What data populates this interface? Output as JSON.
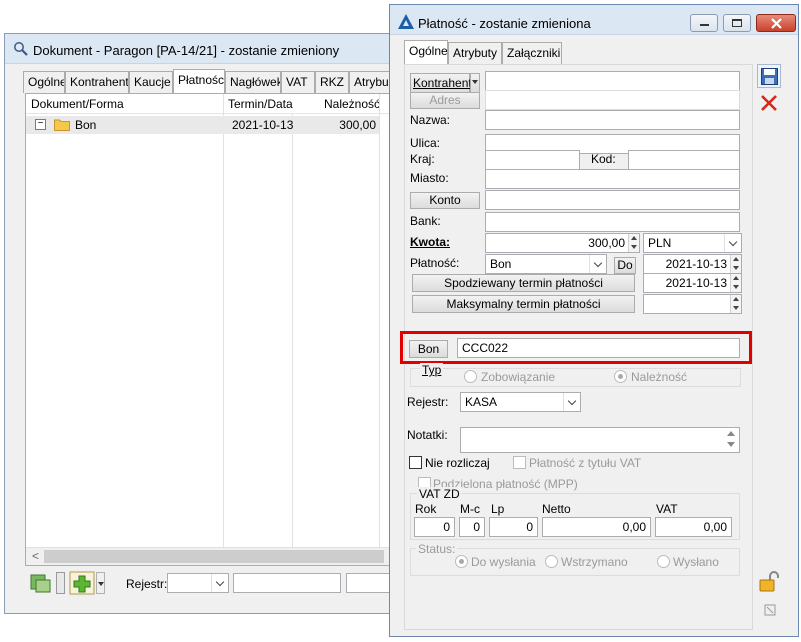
{
  "back": {
    "title": "Dokument - Paragon [PA-14/21]  - zostanie zmieniony",
    "tabs": [
      "Ogólne",
      "Kontrahent",
      "Kaucje",
      "Płatności",
      "Nagłówek",
      "VAT",
      "RKZ",
      "Atrybu"
    ],
    "columns": [
      "Dokument/Forma",
      "Termin/Data",
      "Należność"
    ],
    "row": {
      "toggle": "−",
      "name": "Bon",
      "date": "2021-10-13",
      "amount": "300,00"
    },
    "scroll_left": "<",
    "rejestr_label": "Rejestr:"
  },
  "front": {
    "title": "Płatność - zostanie zmieniona",
    "tabs": [
      "Ogólne",
      "Atrybuty",
      "Załączniki"
    ],
    "kontrahent_btn": "Kontrahent",
    "adres_btn": "Adres",
    "nazwa": "Nazwa:",
    "ulica": "Ulica:",
    "kraj": "Kraj:",
    "kod": "Kod:",
    "miasto": "Miasto:",
    "konto_btn": "Konto",
    "bank": "Bank:",
    "kwota_label": "Kwota:",
    "kwota_value": "300,00",
    "currency": "PLN",
    "platnosc_label": "Płatność:",
    "platnosc_value": "Bon",
    "do_btn": "Do",
    "date1": "2021-10-13",
    "date2": "2021-10-13",
    "spodziewany_btn": "Spodziewany termin płatności",
    "maksymalny_btn": "Maksymalny termin płatności",
    "bon_btn": "Bon",
    "bon_value": "CCC022",
    "typ_label": "Typ",
    "zobowiazanie": "Zobowiązanie",
    "naleznosc": "Należność",
    "rejestr_label": "Rejestr:",
    "rejestr_value": "KASA",
    "notatki": "Notatki:",
    "nie_rozliczaj": "Nie rozliczaj",
    "platnosc_vat": "Płatność z tytułu VAT",
    "podzielona": "Podzielona płatność (MPP)",
    "vatzd": "VAT ZD",
    "vat_cols": [
      "Rok",
      "M-c",
      "Lp",
      "Netto",
      "VAT"
    ],
    "vat_vals": [
      "0",
      "0",
      "0",
      "0,00",
      "0,00"
    ],
    "status_label": "Status:",
    "status_opts": [
      "Do wysłania",
      "Wstrzymano",
      "Wysłano"
    ]
  },
  "colors": {
    "highlight": "#e00000",
    "accent": "#1a5fa8"
  }
}
